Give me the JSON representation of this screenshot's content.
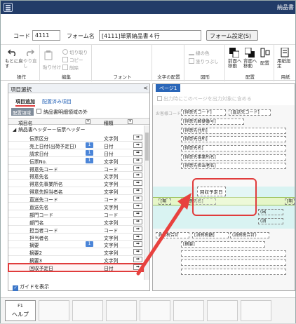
{
  "window": {
    "title": "納品書",
    "close": "✕"
  },
  "form": {
    "code_label": "コード",
    "code_value": "4111",
    "name_label": "フォーム名",
    "name_value": "[4111]単票納品書４行",
    "settings_button": "フォーム設定(S)"
  },
  "ribbon": {
    "undo": "もとに戻す",
    "redo": "やり直し",
    "cut": "切り取り",
    "copy": "コピー",
    "paste": "貼り付け",
    "delete": "削除",
    "line_color": "線の色",
    "fill": "塗りつぶし",
    "bring_front": "前面へ移動",
    "send_back": "背面へ移動",
    "arrange": "配置",
    "paper_settings": "用紙設定",
    "groups": {
      "operation": "操作",
      "edit": "編集",
      "font": "フォント",
      "text_align": "文字の配置",
      "shape": "図形",
      "arrange": "配置",
      "paper": "用紙"
    }
  },
  "left_panel": {
    "header": "項目選択",
    "collapse": "<",
    "tab_add": "項目追加",
    "tab_placed": "配置済み項目",
    "scope_label": "配置領域",
    "scope_option": "納品書明細領域の外",
    "col_name": "項目名",
    "col_type": "種類",
    "group": "納品書ヘッダー－伝票ヘッダー",
    "rows": [
      {
        "name": "伝票区分",
        "badge": "",
        "type": "文字列"
      },
      {
        "name": "売上日付(出荷予定日)",
        "badge": "1",
        "type": "日付"
      },
      {
        "name": "請求日付",
        "badge": "1",
        "type": "日付"
      },
      {
        "name": "伝票No.",
        "badge": "1",
        "type": "文字列"
      },
      {
        "name": "得意先コード",
        "badge": "",
        "type": "コード"
      },
      {
        "name": "得意先名",
        "badge": "",
        "type": "文字列"
      },
      {
        "name": "得意先事業所名",
        "badge": "",
        "type": "文字列"
      },
      {
        "name": "得意先担当者名",
        "badge": "",
        "type": "文字列"
      },
      {
        "name": "直送先コード",
        "badge": "",
        "type": "コード"
      },
      {
        "name": "直送先名",
        "badge": "",
        "type": "文字列"
      },
      {
        "name": "部門コード",
        "badge": "",
        "type": "コード"
      },
      {
        "name": "部門名",
        "badge": "",
        "type": "文字列"
      },
      {
        "name": "担当者コード",
        "badge": "",
        "type": "コード"
      },
      {
        "name": "担当者名",
        "badge": "",
        "type": "文字列"
      },
      {
        "name": "摘要",
        "badge": "1",
        "type": "文字列"
      },
      {
        "name": "摘要2",
        "badge": "",
        "type": "文字列"
      },
      {
        "name": "摘要3",
        "badge": "",
        "type": "文字列"
      },
      {
        "name": "回収予定日",
        "badge": "",
        "type": "日付"
      }
    ],
    "arrow_glyph": "➡",
    "guide": "ガイドを表示"
  },
  "right_panel": {
    "tab": "ページ1",
    "print_all_pages": "出力時にこのページを出力対象に含める",
    "canvas_fields": {
      "section": "お客様コード欄",
      "cust_code": "[得意先コード]",
      "direct_code": "[直送先コード]",
      "zip": "[得意先郵便番号]",
      "addr1": "[得意先住所]",
      "addr2": "[得意先住所]",
      "name": "[得意先名]",
      "office": "[得意先事業所名]",
      "person": "[得意先担当者名]",
      "row_name": "[得意先名]",
      "dropped": "回収予定日",
      "hdr_left": "[明",
      "hdr_right": "[明",
      "ex": "(出",
      "tax": "(消",
      "rate": "消費税合計",
      "total": "[消費税額]",
      "tax_rate": "(消費税合計)",
      "summary": "[摘要]"
    }
  },
  "footer": {
    "key": "F1",
    "label": "ヘルプ"
  }
}
